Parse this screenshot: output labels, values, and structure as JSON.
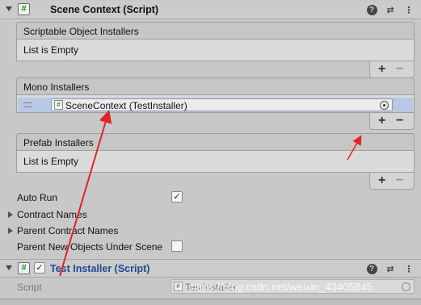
{
  "scene_context": {
    "title": "Scene Context (Script)",
    "icon": "#",
    "header_icons": [
      "help-icon",
      "presets-icon",
      "context-menu-icon"
    ],
    "help_glyph": "?",
    "presets_glyph": "⇄",
    "menu_glyph": "⋮"
  },
  "scriptable_installers": {
    "label": "Scriptable Object Installers",
    "empty_text": "List is Empty",
    "add": "+",
    "remove": "−"
  },
  "mono_installers": {
    "label": "Mono Installers",
    "item_icon": "#",
    "item_value": "SceneContext (TestInstaller)",
    "add": "+",
    "remove": "−"
  },
  "prefab_installers": {
    "label": "Prefab Installers",
    "empty_text": "List is Empty",
    "add": "+",
    "remove": "−"
  },
  "props": {
    "auto_run": "Auto Run",
    "auto_run_check": "✓",
    "contract_names": "Contract Names",
    "parent_contract_names": "Parent Contract Names",
    "parent_new_objects": "Parent New Objects Under Scene"
  },
  "test_installer": {
    "icon": "#",
    "enabled_check": "✓",
    "title": "Test Installer (Script)",
    "title_color": "#1e4a92",
    "script_label": "Script",
    "script_icon": "#",
    "script_value": "TestInstaller"
  },
  "watermark": "https://blog.csdn.net/weixin_43405845",
  "colors": {
    "annotation_arrow": "#e02424",
    "selected_row": "#b7c9e6"
  }
}
